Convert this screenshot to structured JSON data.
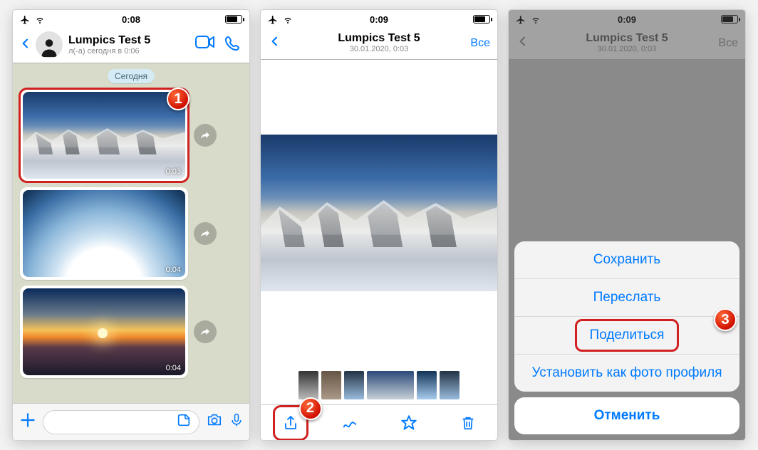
{
  "status": {
    "time1": "0:08",
    "time2": "0:09",
    "time3": "0:09"
  },
  "screen1": {
    "chat_name": "Lumpics Test 5",
    "last_seen": "л(-а) сегодня в 0:06",
    "date_label": "Сегодня",
    "msg1_time": "0:03",
    "msg2_time": "0:04",
    "msg3_time": "0:04"
  },
  "screen2": {
    "title": "Lumpics Test 5",
    "sub": "30.01.2020, 0:03",
    "all": "Все"
  },
  "screen3": {
    "title": "Lumpics Test 5",
    "sub": "30.01.2020, 0:03",
    "all": "Все",
    "save": "Сохранить",
    "forward": "Переслать",
    "share": "Поделиться",
    "set_photo": "Установить как фото профиля",
    "cancel": "Отменить"
  },
  "badges": {
    "b1": "1",
    "b2": "2",
    "b3": "3"
  }
}
